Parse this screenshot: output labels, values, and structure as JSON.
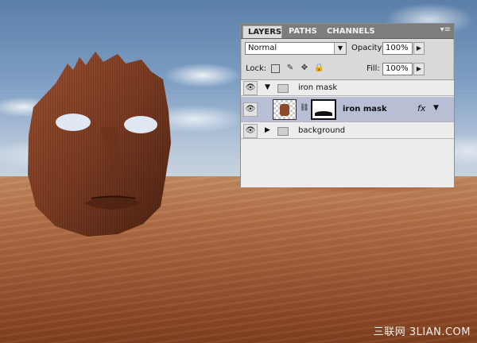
{
  "panel": {
    "tabs": [
      {
        "label": "LAYERS",
        "active": true
      },
      {
        "label": "PATHS",
        "active": false
      },
      {
        "label": "CHANNELS",
        "active": false
      }
    ],
    "menu_icon": "panel-menu-icon",
    "blend_mode": "Normal",
    "opacity_label": "Opacity:",
    "opacity_value": "100%",
    "lock_label": "Lock:",
    "lock_icons": [
      "lock-transparency-icon",
      "lock-paint-icon",
      "lock-move-icon",
      "lock-all-icon"
    ],
    "fill_label": "Fill:",
    "fill_value": "100%",
    "layers": [
      {
        "name": "iron mask",
        "type": "group",
        "expanded": true,
        "visible": true
      },
      {
        "name": "iron mask",
        "type": "layer",
        "selected": true,
        "visible": true,
        "has_mask": true,
        "fx_label": "fx"
      },
      {
        "name": "background",
        "type": "group",
        "expanded": false,
        "visible": true
      }
    ],
    "selected_layer_color": "#b8bfd4"
  },
  "watermark": "三联网 3LIAN.COM",
  "scene": {
    "subject": "rust-iron-mask",
    "sky_color": "#6f8fb8",
    "sand_color": "#a8603a"
  }
}
